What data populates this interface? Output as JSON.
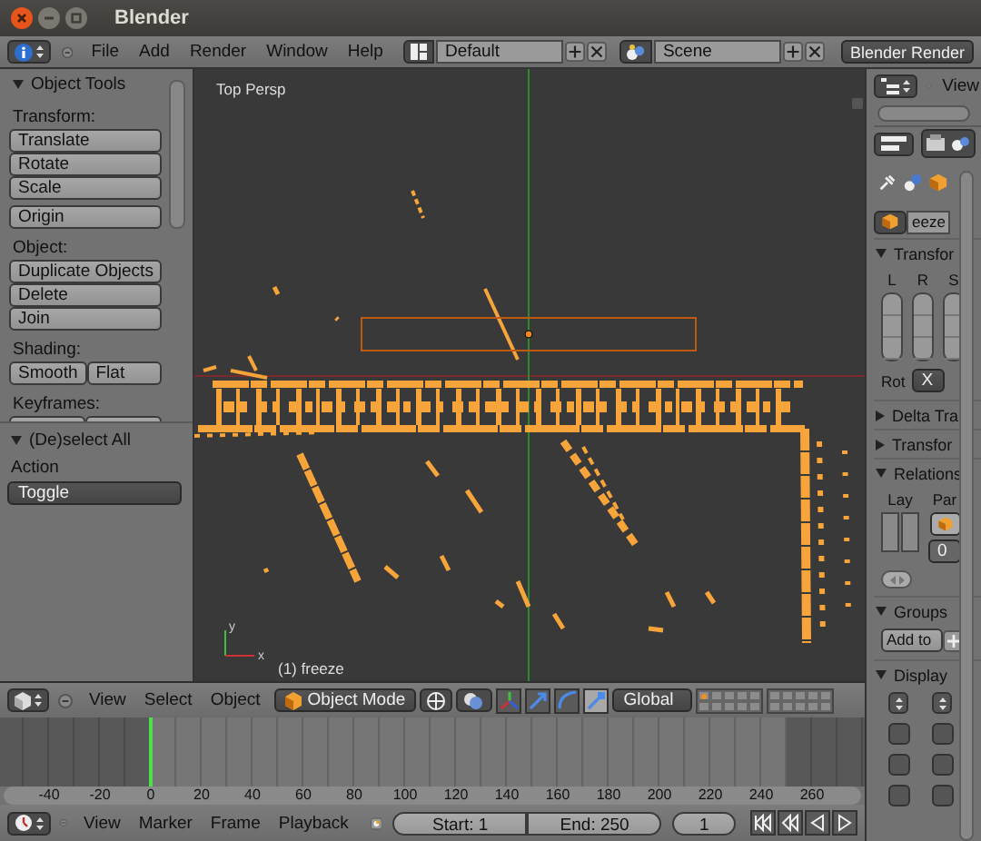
{
  "window": {
    "title": "Blender"
  },
  "info_header": {
    "menus": [
      "File",
      "Add",
      "Render",
      "Window",
      "Help"
    ],
    "screen_layout": "Default",
    "scene": "Scene",
    "render_engine": "Blender Render"
  },
  "tool_shelf": {
    "title": "Object Tools",
    "expanded": true,
    "sections": [
      {
        "kind": "column",
        "label": "Transform:",
        "buttons": [
          "Translate",
          "Rotate",
          "Scale"
        ]
      },
      {
        "kind": "column",
        "buttons": [
          "Origin"
        ]
      },
      {
        "kind": "column",
        "label": "Object:",
        "buttons": [
          "Duplicate Objects",
          "Delete",
          "Join"
        ]
      },
      {
        "kind": "row",
        "label": "Shading:",
        "buttons": [
          "Smooth",
          "Flat"
        ]
      },
      {
        "kind": "cut",
        "label": "Keyframes:"
      }
    ]
  },
  "operator_panel": {
    "title": "(De)select All",
    "expanded": true,
    "field_label": "Action",
    "value": "Toggle"
  },
  "viewport": {
    "view_label": "Top Persp",
    "object_label": "(1) freeze",
    "axis_labels": [
      "y",
      "x"
    ]
  },
  "view3d_header": {
    "menus": [
      "View",
      "Select",
      "Object"
    ],
    "mode": "Object Mode",
    "orientation": "Global",
    "manipulators": [
      {
        "kind": "axes",
        "selected": false
      },
      {
        "kind": "translate",
        "selected": false
      },
      {
        "kind": "rotate",
        "selected": false
      },
      {
        "kind": "scale",
        "selected": true
      }
    ],
    "layers": [
      {
        "has_objects": true
      },
      {
        "has_objects": false
      },
      {
        "has_objects": false
      },
      {
        "has_objects": false
      },
      {
        "has_objects": false
      },
      {
        "has_objects": false
      },
      {
        "has_objects": false
      },
      {
        "has_objects": false
      },
      {
        "has_objects": false
      },
      {
        "has_objects": false
      },
      {
        "has_objects": false
      },
      {
        "has_objects": false
      },
      {
        "has_objects": false
      },
      {
        "has_objects": false
      },
      {
        "has_objects": false
      },
      {
        "has_objects": false
      },
      {
        "has_objects": false
      },
      {
        "has_objects": false
      },
      {
        "has_objects": false
      },
      {
        "has_objects": false
      }
    ]
  },
  "timeline": {
    "ruler": [
      "-40",
      "-20",
      "0",
      "20",
      "40",
      "60",
      "80",
      "100",
      "120",
      "140",
      "160",
      "180",
      "200",
      "220",
      "240",
      "260"
    ]
  },
  "timeline_header": {
    "menus": [
      "View",
      "Marker",
      "Frame",
      "Playback"
    ],
    "start": "Start: 1",
    "end": "End: 250",
    "current": "1"
  },
  "properties": {
    "view_menu": "View",
    "object_name": "eeze",
    "panels": [
      {
        "kind": "transform",
        "title": "Transfor",
        "expanded": true,
        "columns": [
          "L",
          "R",
          "S"
        ],
        "rotation_label": "Rot",
        "rotation_mode": "X"
      },
      {
        "title": "Delta Tra",
        "expanded": false
      },
      {
        "title": "Transfor",
        "expanded": false
      },
      {
        "kind": "relations",
        "title": "Relations",
        "expanded": true,
        "layer_label": "Lay",
        "parent_label": "Par",
        "parent_type": "0"
      },
      {
        "kind": "groups",
        "title": "Groups",
        "expanded": true,
        "button": "Add to"
      },
      {
        "kind": "display",
        "title": "Display",
        "expanded": true,
        "checkboxes": [
          {
            "checked": false
          },
          {
            "checked": false
          },
          {
            "checked": false
          },
          {
            "checked": false
          },
          {
            "checked": false
          },
          {
            "checked": false
          }
        ]
      }
    ]
  }
}
